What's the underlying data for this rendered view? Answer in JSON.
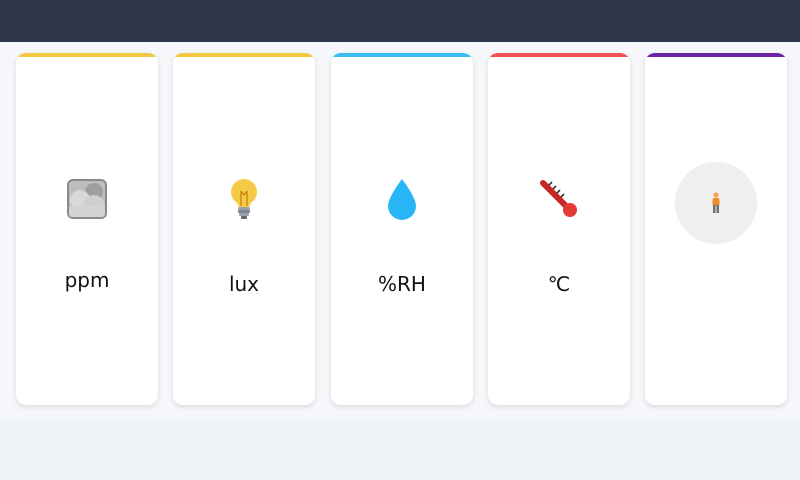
{
  "cards": [
    {
      "unit": "ppm",
      "accent_color": "#f5c842",
      "icon": "cloud-air-quality-icon"
    },
    {
      "unit": "lux",
      "accent_color": "#f5c842",
      "icon": "light-bulb-icon"
    },
    {
      "unit": "%RH",
      "accent_color": "#38bdf8",
      "icon": "water-drop-icon"
    },
    {
      "unit": "℃",
      "accent_color": "#f05252",
      "icon": "thermometer-icon"
    },
    {
      "unit": "",
      "accent_color": "#6b21a8",
      "icon": "person-icon"
    }
  ]
}
